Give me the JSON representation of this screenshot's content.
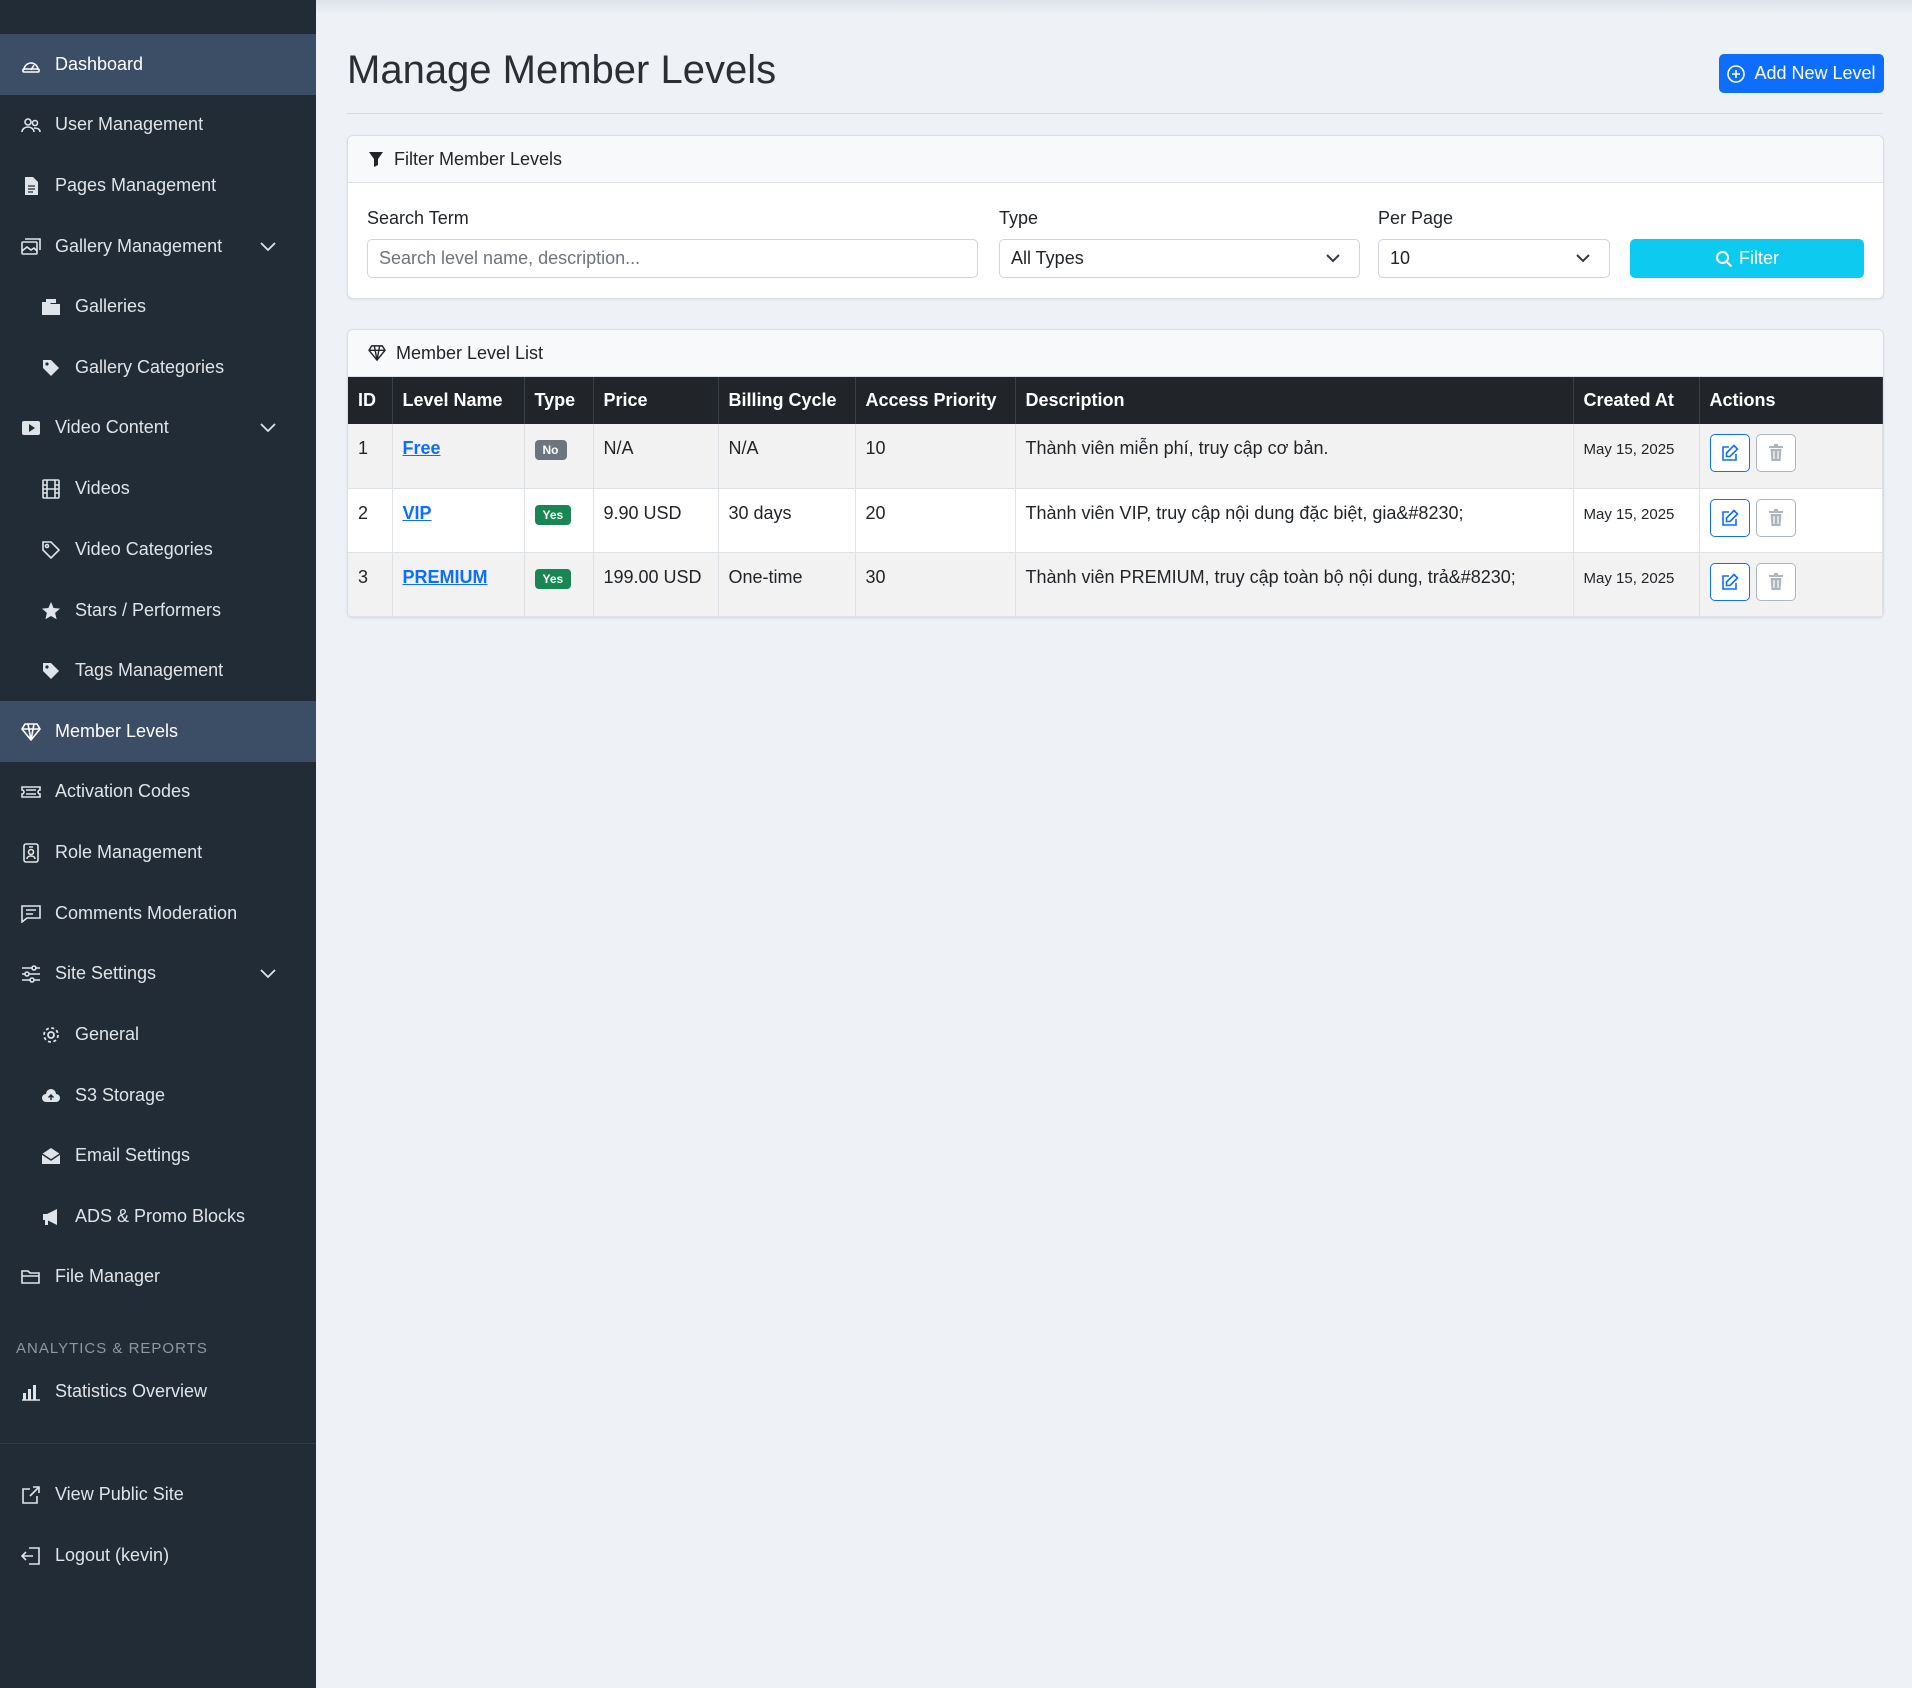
{
  "sidebar": {
    "items": [
      {
        "label": "Dashboard",
        "icon": "speedometer-icon",
        "active": true
      },
      {
        "label": "User Management",
        "icon": "people-icon"
      },
      {
        "label": "Pages Management",
        "icon": "file-text-icon"
      },
      {
        "label": "Gallery Management",
        "icon": "images-icon",
        "expandable": true
      },
      {
        "label": "Galleries",
        "icon": "folder-icon"
      },
      {
        "label": "Gallery Categories",
        "icon": "tags-icon"
      },
      {
        "label": "Video Content",
        "icon": "play-btn-icon",
        "expandable": true
      },
      {
        "label": "Videos",
        "icon": "film-icon"
      },
      {
        "label": "Video Categories",
        "icon": "tags-outline-icon"
      },
      {
        "label": "Stars / Performers",
        "icon": "star-icon"
      },
      {
        "label": "Tags Management",
        "icon": "tag-icon"
      },
      {
        "label": "Member Levels",
        "icon": "gem-icon",
        "active": true
      },
      {
        "label": "Activation Codes",
        "icon": "ticket-icon"
      },
      {
        "label": "Role Management",
        "icon": "person-badge-icon"
      },
      {
        "label": "Comments Moderation",
        "icon": "chat-square-icon"
      },
      {
        "label": "Site Settings",
        "icon": "sliders-icon",
        "expandable": true
      },
      {
        "label": "General",
        "icon": "gear-icon"
      },
      {
        "label": "S3 Storage",
        "icon": "cloud-upload-icon"
      },
      {
        "label": "Email Settings",
        "icon": "envelope-icon"
      },
      {
        "label": "ADS & Promo Blocks",
        "icon": "megaphone-icon"
      },
      {
        "label": "File Manager",
        "icon": "folder-open-icon"
      }
    ],
    "section_title": "ANALYTICS & REPORTS",
    "analytics": [
      {
        "label": "Statistics Overview",
        "icon": "bar-chart-icon"
      }
    ],
    "footer": [
      {
        "label": "View Public Site",
        "icon": "external-link-icon"
      },
      {
        "label": "Logout (kevin)",
        "icon": "logout-icon"
      }
    ]
  },
  "page": {
    "title": "Manage Member Levels",
    "add_button": "Add New Level"
  },
  "filter": {
    "header": "Filter Member Levels",
    "search_label": "Search Term",
    "search_placeholder": "Search level name, description...",
    "type_label": "Type",
    "type_value": "All Types",
    "per_page_label": "Per Page",
    "per_page_value": "10",
    "button": "Filter"
  },
  "list": {
    "header": "Member Level List",
    "columns": [
      "ID",
      "Level Name",
      "Type",
      "Price",
      "Billing Cycle",
      "Access Priority",
      "Description",
      "Created At",
      "Actions"
    ],
    "rows": [
      {
        "id": "1",
        "name": "Free",
        "type": "No",
        "price": "N/A",
        "cycle": "N/A",
        "priority": "10",
        "description": "Thành viên miễn phí, truy cập cơ bản.",
        "created": "May 15, 2025"
      },
      {
        "id": "2",
        "name": "VIP",
        "type": "Yes",
        "price": "9.90 USD",
        "cycle": "30 days",
        "priority": "20",
        "description": "Thành viên VIP, truy cập nội dung đặc biệt, gia&#8230;",
        "created": "May 15, 2025"
      },
      {
        "id": "3",
        "name": "PREMIUM",
        "type": "Yes",
        "price": "199.00 USD",
        "cycle": "One-time",
        "priority": "30",
        "description": "Thành viên PREMIUM, truy cập toàn bộ nội dung, trả&#8230;",
        "created": "May 15, 2025"
      }
    ]
  },
  "colors": {
    "sidebar_bg": "#222c36",
    "sidebar_active": "#3c4e66",
    "primary": "#0d6efd",
    "info": "#0dcaf0",
    "success": "#198754",
    "secondary": "#6c757d",
    "table_header": "#212529"
  }
}
